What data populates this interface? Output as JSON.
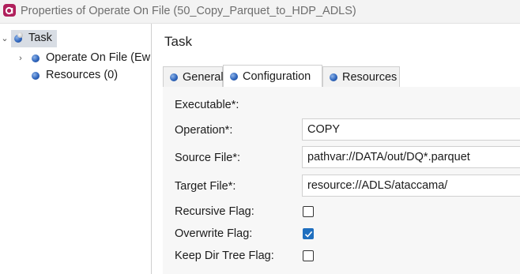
{
  "window": {
    "title": "Properties of Operate On File (50_Copy_Parquet_to_HDP_ADLS)"
  },
  "tree": {
    "root": {
      "twisty": "⌄",
      "label": "Task"
    },
    "children": [
      {
        "twisty": "›",
        "label": "Operate On File (Ew"
      },
      {
        "twisty": "",
        "label": "Resources (0)"
      }
    ]
  },
  "panel": {
    "title": "Task",
    "tabs": [
      {
        "label": "General",
        "active": false
      },
      {
        "label": "Configuration",
        "active": true
      },
      {
        "label": "Resources",
        "active": false
      }
    ]
  },
  "form": {
    "executable_label": "Executable*:",
    "operation": {
      "label": "Operation*:",
      "value": "COPY"
    },
    "source_file": {
      "label": "Source File*:",
      "value": "pathvar://DATA/out/DQ*.parquet"
    },
    "target_file": {
      "label": "Target File*:",
      "value": "resource://ADLS/ataccama/"
    },
    "recursive_flag": {
      "label": "Recursive Flag:",
      "checked": false
    },
    "overwrite_flag": {
      "label": "Overwrite Flag:",
      "checked": true
    },
    "keep_dir_tree_flag": {
      "label": "Keep Dir Tree Flag:",
      "checked": false
    }
  },
  "colors": {
    "accent": "#1f6fbf",
    "app_icon": "#b0205c",
    "selection": "#d8dde4"
  },
  "icons": {
    "app": "app-logo-icon",
    "node": "blue-ball-icon",
    "task": "task-cog-icon"
  }
}
